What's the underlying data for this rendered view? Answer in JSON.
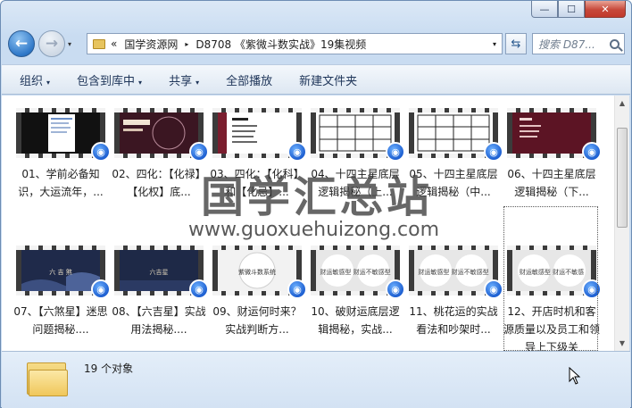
{
  "window": {
    "min_icon": "minimize-icon",
    "max_icon": "maximize-icon",
    "close_icon": "close-icon",
    "min_label": "—",
    "max_label": "☐",
    "close_label": "✕"
  },
  "nav": {
    "back_label": "←",
    "forward_label": "→",
    "history_dropdown": "▾"
  },
  "address": {
    "root_chevron": "«",
    "crumbs": [
      "国学资源网",
      "D8708 《紫微斗数实战》19集视频"
    ],
    "separator": "▸",
    "dropdown": "▾"
  },
  "refresh_label": "⇆",
  "search": {
    "placeholder": "搜索 D87..."
  },
  "toolbar": {
    "organize": "组织",
    "include_library": "包含到库中",
    "share": "共享",
    "play_all": "全部播放",
    "new_folder": "新建文件夹",
    "arrow": "▾"
  },
  "items": [
    {
      "caption": "01、学前必备知识，大运流年，...",
      "thumb": "dark-doc"
    },
    {
      "caption": "02、四化：【化禄】【化权】底...",
      "thumb": "dark-red"
    },
    {
      "caption": "03、四化：【化科】和【化忌】...",
      "thumb": "red-white"
    },
    {
      "caption": "04、十四主星底层逻辑揭秘（上...",
      "thumb": "grid"
    },
    {
      "caption": "05、十四主星底层逻辑揭秘（中...",
      "thumb": "grid"
    },
    {
      "caption": "06、十四主星底层逻辑揭秘（下...",
      "thumb": "dark-red-list"
    },
    {
      "caption": "07、【六煞星】迷思问题揭秘....",
      "thumb": "navy-wave",
      "overlay": "六 吉 煞"
    },
    {
      "caption": "08、【六吉星】实战用法揭秘....",
      "thumb": "navy",
      "overlay": "六吉星"
    },
    {
      "caption": "09、财运何时来？实战判断方...",
      "thumb": "white-bubble",
      "overlay": "紫微斗数系统"
    },
    {
      "caption": "10、破财运底层逻辑揭秘，实战...",
      "thumb": "gray-bubbles",
      "overlay": "财运敏感型   财运不敏感型"
    },
    {
      "caption": "11、桃花运的实战看法和吵架时...",
      "thumb": "gray-bubbles",
      "overlay": "财运敏感型   财运不敏感型"
    },
    {
      "caption": "12、开店时机和客源质量以及员工和领导上下级关",
      "thumb": "gray-bubbles",
      "overlay": "财运敏感型   财运不敏感"
    }
  ],
  "status": {
    "count": "19 个对象"
  },
  "watermark": {
    "title": "国学汇总站",
    "url": "www.guoxuehuizong.com"
  },
  "colors": {
    "accent": "#2f78c8",
    "toolbar_text": "#1e3559",
    "badge": "#1d5fd1"
  }
}
